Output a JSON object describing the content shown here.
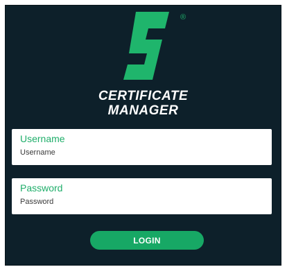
{
  "brand": {
    "logo_icon": "certificate-manager-logo-icon",
    "registered_mark": "®",
    "title_line1": "CERTIFICATE",
    "title_line2": "MANAGER",
    "accent_color": "#17a865",
    "background_color": "#0d202a"
  },
  "form": {
    "username": {
      "label": "Username",
      "placeholder": "Username",
      "value": ""
    },
    "password": {
      "label": "Password",
      "placeholder": "Password",
      "value": ""
    },
    "login_label": "LOGIN"
  }
}
